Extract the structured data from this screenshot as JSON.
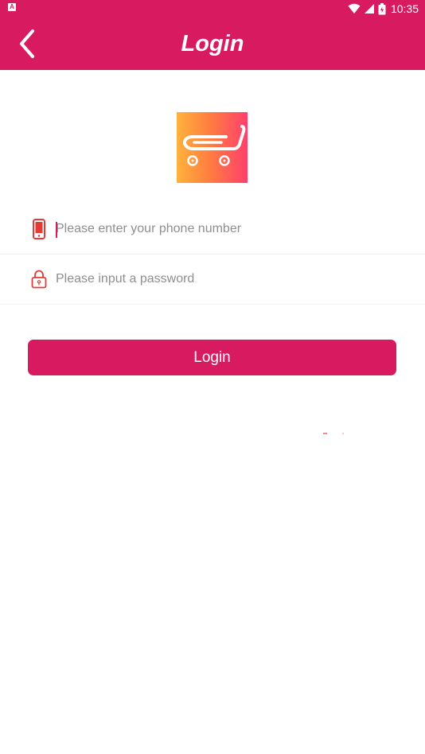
{
  "status_bar": {
    "time": "10:35",
    "left_icon": "notification-a-icon",
    "icons": [
      "wifi-icon",
      "signal-icon",
      "battery-icon"
    ]
  },
  "header": {
    "title": "Login",
    "back_icon": "chevron-left-icon"
  },
  "logo": {
    "icon": "shopping-cart-icon"
  },
  "form": {
    "phone": {
      "icon": "phone-icon",
      "placeholder": "Please enter your phone number",
      "value": ""
    },
    "password": {
      "icon": "lock-icon",
      "placeholder": "Please input a password",
      "value": ""
    },
    "login_label": "Login"
  },
  "colors": {
    "primary": "#d81b60",
    "placeholder": "#8e8e8e",
    "icon_red": "#e53935"
  }
}
